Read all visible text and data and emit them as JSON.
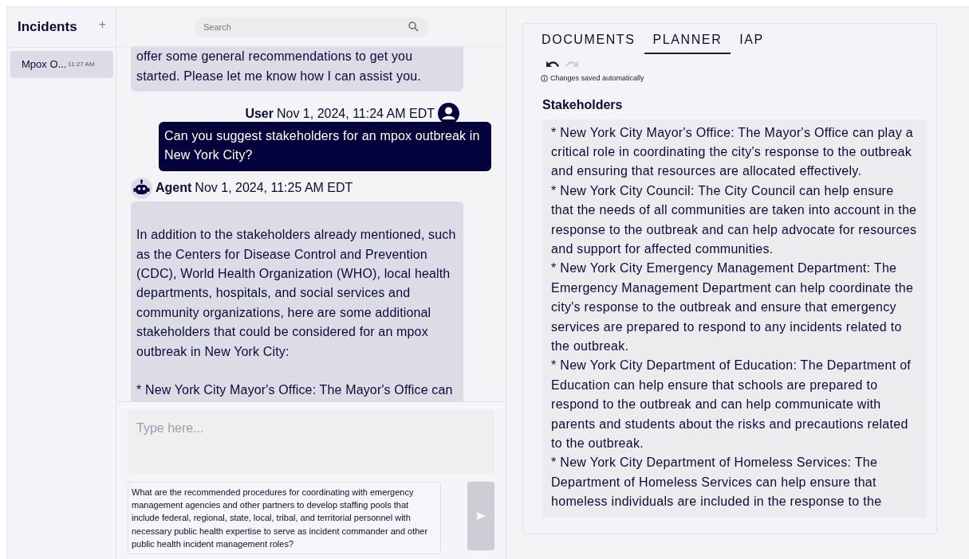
{
  "sidebar": {
    "title": "Incidents",
    "add_label": "+",
    "items": [
      {
        "name": "Mpox O...",
        "time": "11:27 AM",
        "selected": true
      }
    ]
  },
  "search": {
    "placeholder": "Search"
  },
  "messages": [
    {
      "kind": "agent",
      "continued": true,
      "paragraphs": [
        "offer some general recommendations to get you started. Please let me know how I can assist you."
      ]
    },
    {
      "kind": "user",
      "author": "User",
      "time": "Nov 1, 2024, 11:24 AM EDT",
      "paragraphs": [
        "Can you suggest stakeholders for an mpox outbreak in New York City?"
      ]
    },
    {
      "kind": "agent",
      "author": "Agent",
      "time": "Nov 1, 2024, 11:25 AM EDT",
      "paragraphs": [
        "In addition to the stakeholders already mentioned, such as the Centers for Disease Control and Prevention (CDC), World Health Organization (WHO), local health departments, hospitals, and social services and community organizations, here are some additional stakeholders that could be considered for an mpox outbreak in New York City:",
        "* New York City Mayor's Office: The Mayor's Office can"
      ]
    }
  ],
  "composer": {
    "placeholder": "Type here...",
    "suggestion": "What are the recommended procedures for coordinating with emergency management agencies and other partners to develop staffing pools that include federal, regional, state, local, tribal, and territorial personnel with necessary public health expertise to serve as incident commander and other public health incident management roles?",
    "send_disabled": true
  },
  "tabs": [
    {
      "label": "DOCUMENTS",
      "selected": false
    },
    {
      "label": "PLANNER",
      "selected": true
    },
    {
      "label": "IAP",
      "selected": false
    }
  ],
  "toolbar": {
    "undo_disabled": false,
    "redo_disabled": true
  },
  "save_note": "Changes saved automatically",
  "section": {
    "title": "Stakeholders",
    "lines": [
      "* New York City Mayor's Office: The Mayor's Office can play a critical role in coordinating the city's response to the outbreak and ensuring that resources are allocated effectively.",
      "* New York City Council: The City Council can help ensure that the needs of all communities are taken into account in the response to the outbreak and can help advocate for resources and support for affected communities.",
      "* New York City Emergency Management Department: The Emergency Management Department can help coordinate the city's response to the outbreak and ensure that emergency services are prepared to respond to any incidents related to the outbreak.",
      "* New York City Department of Education: The Department of Education can help ensure that schools are prepared to respond to the outbreak and can help communicate with parents and students about the risks and precautions related to the outbreak.",
      "* New York City Department of Homeless Services: The Department of Homeless Services can help ensure that homeless individuals are included in the response to the"
    ]
  }
}
